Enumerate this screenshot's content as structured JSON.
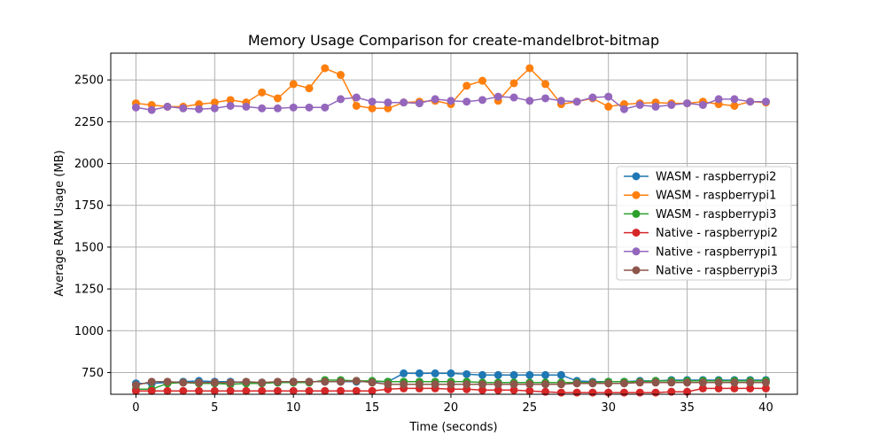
{
  "chart_data": {
    "type": "line",
    "title": "Memory Usage Comparison for create-mandelbrot-bitmap",
    "xlabel": "Time (seconds)",
    "ylabel": "Average RAM Usage (MB)",
    "xlim": [
      -1.6,
      42
    ],
    "ylim": [
      620,
      2660
    ],
    "xticks": [
      0,
      5,
      10,
      15,
      20,
      25,
      30,
      35,
      40
    ],
    "yticks": [
      750,
      1000,
      1250,
      1500,
      1750,
      2000,
      2250,
      2500
    ],
    "grid": true,
    "legend_position": "center-right",
    "series": [
      {
        "name": "WASM - raspberrypi2",
        "color": "#1f77b4",
        "x": [
          0,
          1,
          2,
          3,
          4,
          5,
          6,
          7,
          8,
          9,
          10,
          11,
          12,
          13,
          14,
          15,
          16,
          17,
          18,
          19,
          20,
          21,
          22,
          23,
          24,
          25,
          26,
          27,
          28,
          29,
          30,
          31,
          32,
          33,
          34,
          35,
          36,
          37,
          38,
          39,
          40
        ],
        "y": [
          685,
          685,
          690,
          695,
          700,
          695,
          695,
          690,
          690,
          690,
          695,
          695,
          695,
          695,
          695,
          695,
          695,
          745,
          745,
          745,
          745,
          740,
          735,
          735,
          735,
          735,
          735,
          735,
          700,
          695,
          695,
          695,
          700,
          700,
          705,
          705,
          705,
          705,
          705,
          705,
          705
        ]
      },
      {
        "name": "WASM - raspberrypi1",
        "color": "#ff7f0e",
        "x": [
          0,
          1,
          2,
          3,
          4,
          5,
          6,
          7,
          8,
          9,
          10,
          11,
          12,
          13,
          14,
          15,
          16,
          17,
          18,
          19,
          20,
          21,
          22,
          23,
          24,
          25,
          26,
          27,
          28,
          29,
          30,
          31,
          32,
          33,
          34,
          35,
          36,
          37,
          38,
          39,
          40
        ],
        "y": [
          2360,
          2350,
          2340,
          2340,
          2355,
          2365,
          2380,
          2365,
          2425,
          2390,
          2475,
          2450,
          2570,
          2530,
          2345,
          2330,
          2330,
          2365,
          2370,
          2375,
          2355,
          2465,
          2495,
          2375,
          2480,
          2570,
          2475,
          2355,
          2370,
          2390,
          2340,
          2355,
          2360,
          2365,
          2360,
          2360,
          2370,
          2355,
          2345,
          2370,
          2365
        ]
      },
      {
        "name": "WASM - raspberrypi3",
        "color": "#2ca02c",
        "x": [
          0,
          1,
          2,
          3,
          4,
          5,
          6,
          7,
          8,
          9,
          10,
          11,
          12,
          13,
          14,
          15,
          16,
          17,
          18,
          19,
          20,
          21,
          22,
          23,
          24,
          25,
          26,
          27,
          28,
          29,
          30,
          31,
          32,
          33,
          34,
          35,
          36,
          37,
          38,
          39,
          40
        ],
        "y": [
          650,
          650,
          685,
          690,
          685,
          685,
          680,
          685,
          685,
          690,
          690,
          690,
          705,
          705,
          700,
          700,
          695,
          695,
          695,
          695,
          695,
          695,
          690,
          690,
          690,
          690,
          690,
          690,
          690,
          690,
          695,
          695,
          695,
          700,
          700,
          700,
          700,
          700,
          700,
          700,
          700
        ]
      },
      {
        "name": "Native - raspberrypi2",
        "color": "#d62728",
        "x": [
          0,
          1,
          2,
          3,
          4,
          5,
          6,
          7,
          8,
          9,
          10,
          11,
          12,
          13,
          14,
          15,
          16,
          17,
          18,
          19,
          20,
          21,
          22,
          23,
          24,
          25,
          26,
          27,
          28,
          29,
          30,
          31,
          32,
          33,
          34,
          35,
          36,
          37,
          38,
          39,
          40
        ],
        "y": [
          640,
          640,
          640,
          640,
          640,
          640,
          640,
          640,
          640,
          640,
          640,
          640,
          640,
          640,
          640,
          640,
          650,
          655,
          655,
          655,
          650,
          650,
          645,
          645,
          645,
          640,
          635,
          630,
          630,
          630,
          630,
          630,
          630,
          630,
          635,
          635,
          655,
          655,
          655,
          655,
          655
        ]
      },
      {
        "name": "Native - raspberrypi1",
        "color": "#9467bd",
        "x": [
          0,
          1,
          2,
          3,
          4,
          5,
          6,
          7,
          8,
          9,
          10,
          11,
          12,
          13,
          14,
          15,
          16,
          17,
          18,
          19,
          20,
          21,
          22,
          23,
          24,
          25,
          26,
          27,
          28,
          29,
          30,
          31,
          32,
          33,
          34,
          35,
          36,
          37,
          38,
          39,
          40
        ],
        "y": [
          2335,
          2320,
          2340,
          2330,
          2325,
          2330,
          2345,
          2340,
          2330,
          2330,
          2335,
          2335,
          2335,
          2385,
          2395,
          2370,
          2365,
          2365,
          2360,
          2385,
          2375,
          2370,
          2380,
          2400,
          2395,
          2375,
          2390,
          2375,
          2370,
          2395,
          2400,
          2325,
          2350,
          2340,
          2350,
          2360,
          2350,
          2385,
          2385,
          2370,
          2370
        ]
      },
      {
        "name": "Native - raspberrypi3",
        "color": "#8c564b",
        "x": [
          0,
          1,
          2,
          3,
          4,
          5,
          6,
          7,
          8,
          9,
          10,
          11,
          12,
          13,
          14,
          15,
          16,
          17,
          18,
          19,
          20,
          21,
          22,
          23,
          24,
          25,
          26,
          27,
          28,
          29,
          30,
          31,
          32,
          33,
          34,
          35,
          36,
          37,
          38,
          39,
          40
        ],
        "y": [
          675,
          695,
          695,
          690,
          690,
          690,
          690,
          695,
          690,
          695,
          695,
          695,
          695,
          695,
          700,
          690,
          680,
          680,
          680,
          680,
          680,
          680,
          680,
          680,
          680,
          680,
          680,
          680,
          685,
          685,
          685,
          685,
          690,
          690,
          690,
          690,
          690,
          690,
          690,
          690,
          690
        ]
      }
    ]
  }
}
